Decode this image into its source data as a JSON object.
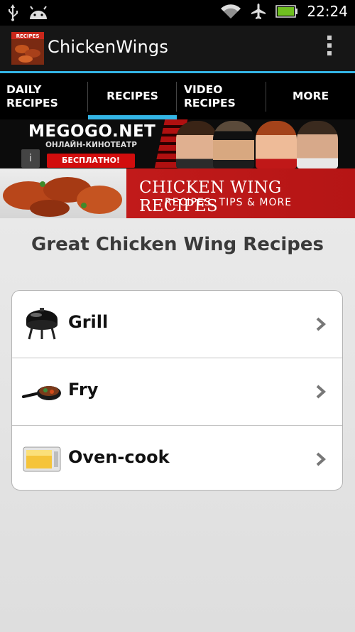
{
  "status_bar": {
    "time": "22:24",
    "icons": [
      "usb-icon",
      "android-icon",
      "wifi-icon",
      "airplane-icon",
      "battery-icon"
    ],
    "battery_color": "#6fbf20"
  },
  "action_bar": {
    "logo_label": "RECIPES",
    "title": "ChickenWings",
    "overflow_icon": "overflow-menu-icon"
  },
  "tabs": [
    {
      "label": "DAILY\nRECIPES",
      "active": false
    },
    {
      "label": "RECIPES",
      "active": true
    },
    {
      "label": "VIDEO\nRECIPES",
      "active": false
    },
    {
      "label": "MORE",
      "active": false
    }
  ],
  "accent_color": "#33b5e5",
  "ad": {
    "brand": "MEGOGO.NET",
    "tagline": "ОНЛАЙН-КИНОТЕАТР",
    "button": "БЕСПЛАТНО!",
    "info_icon": "i"
  },
  "banner": {
    "title": "CHICKEN WING RECIPES",
    "subtitle": "RECIPES, TIPS & MORE"
  },
  "main": {
    "heading": "Great Chicken Wing Recipes",
    "items": [
      {
        "label": "Grill",
        "icon": "grill-icon"
      },
      {
        "label": "Fry",
        "icon": "frying-pan-icon"
      },
      {
        "label": "Oven-cook",
        "icon": "microwave-oven-icon"
      }
    ]
  }
}
